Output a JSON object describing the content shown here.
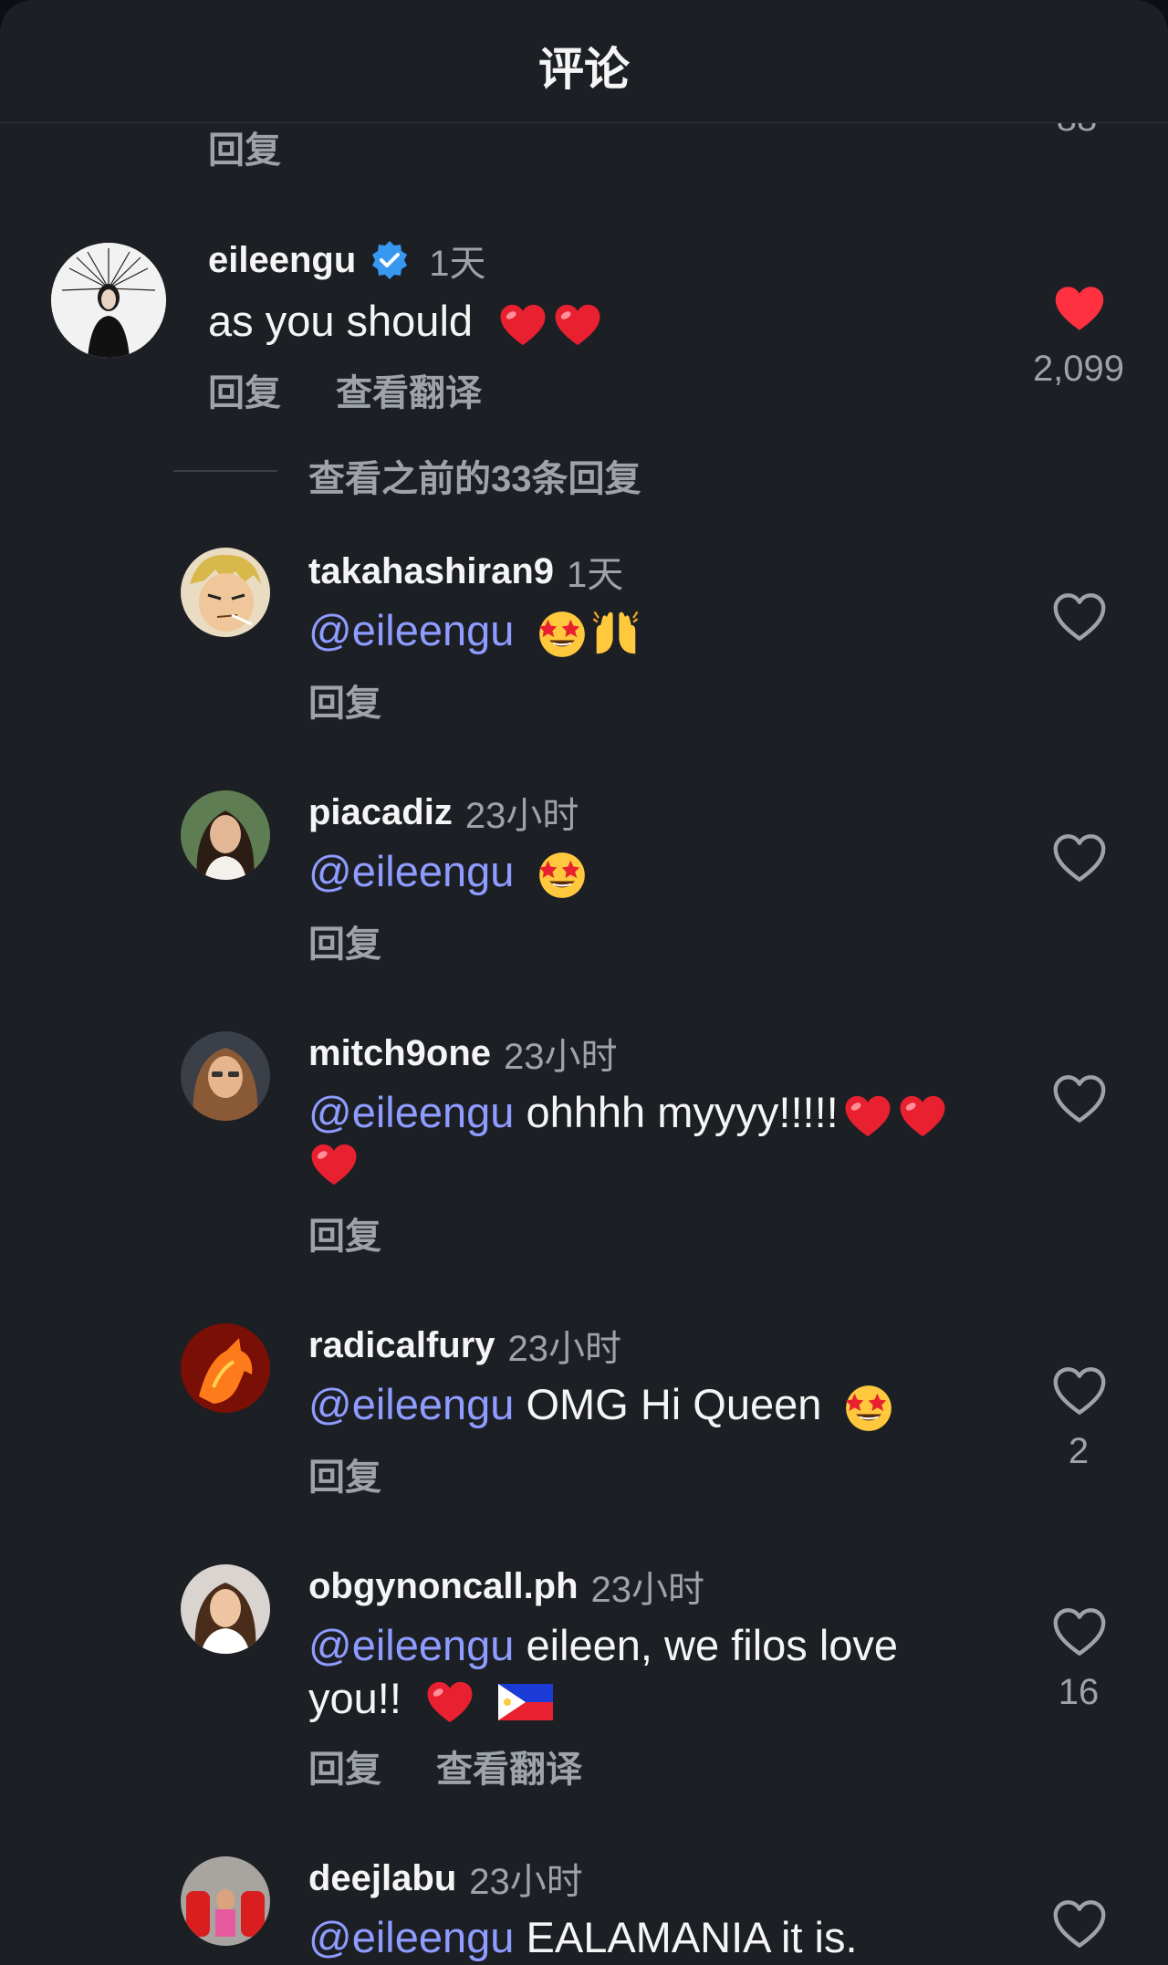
{
  "header": {
    "title": "评论"
  },
  "prev": {
    "reply_label": "回复",
    "like_count": "88"
  },
  "main_comment": {
    "username": "eileengu",
    "time": "1天",
    "text": "as you should",
    "reply_label": "回复",
    "translate_label": "查看翻译",
    "like_count": "2,099"
  },
  "view_previous": "查看之前的33条回复",
  "replies": [
    {
      "username": "takahashiran9",
      "time": "1天",
      "mention": "@eileengu",
      "text": "",
      "reply_label": "回复",
      "like_count": ""
    },
    {
      "username": "piacadiz",
      "time": "23小时",
      "mention": "@eileengu",
      "text": "",
      "reply_label": "回复",
      "like_count": ""
    },
    {
      "username": "mitch9one",
      "time": "23小时",
      "mention": "@eileengu",
      "text": " ohhhh myyyy!!!!!",
      "reply_label": "回复",
      "like_count": ""
    },
    {
      "username": "radicalfury",
      "time": "23小时",
      "mention": "@eileengu",
      "text": " OMG Hi Queen",
      "reply_label": "回复",
      "like_count": "2"
    },
    {
      "username": "obgynoncall.ph",
      "time": "23小时",
      "mention": "@eileengu",
      "text": " eileen, we filos love you!!",
      "reply_label": "回复",
      "translate_label": "查看翻译",
      "like_count": "16"
    },
    {
      "username": "deejlabu",
      "time": "23小时",
      "mention": "@eileengu",
      "text": " EALAMANIA it is.",
      "reply_label": "",
      "like_count": ""
    }
  ],
  "colors": {
    "mention": "#8f9cff",
    "liked_heart": "#ff3040",
    "verified": "#3897f0"
  }
}
